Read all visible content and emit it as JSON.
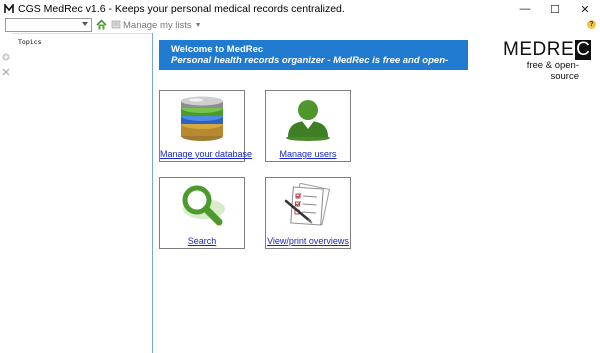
{
  "window": {
    "title": "CGS MedRec v1.6 - Keeps your personal medical records centralized.",
    "controls": {
      "minimize": "—",
      "maximize": "☐",
      "close": "✕"
    }
  },
  "toolbar": {
    "profile_value": "",
    "manage_lists_label": "Manage my lists",
    "help_label": "?",
    "icons": [
      "home-icon",
      "lists-icon",
      "help-icon"
    ]
  },
  "left_panel": {
    "topics_label": "Topics"
  },
  "welcome": {
    "title": "Welcome to MedRec",
    "subtitle": "Personal health records organizer - MedRec is free and open-source"
  },
  "logo": {
    "main": "MEDRE",
    "badge": "C",
    "sub": "free & open-source"
  },
  "tiles": [
    {
      "label": "Manage your database",
      "icon": "database-icon"
    },
    {
      "label": "Manage users",
      "icon": "users-icon"
    },
    {
      "label": "Search",
      "icon": "search-icon"
    },
    {
      "label": "View/print overviews",
      "icon": "overview-icon"
    }
  ],
  "colors": {
    "banner": "#1f7ad0",
    "link": "#1b27c9",
    "accent_green": "#4a8a2a",
    "divider": "#7aa6d9"
  }
}
